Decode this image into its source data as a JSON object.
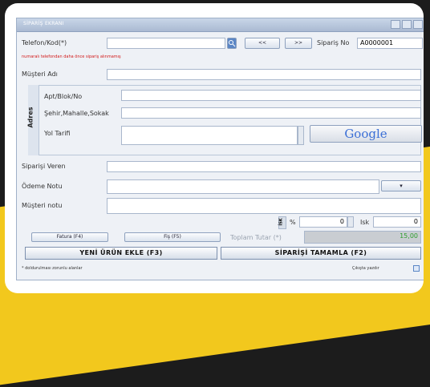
{
  "window": {
    "title": "SİPARİŞ EKRANI"
  },
  "form": {
    "telefon_label": "Telefon/Kod(*)",
    "telefon_value": "",
    "btn_prev": "<<",
    "btn_next": ">>",
    "siparis_no_label": "Sipariş No",
    "siparis_no_value": "A0000001",
    "warning": "numaralı telefondan daha önce sipariş alınmamış",
    "musteri_adi_label": "Müşteri Adı",
    "adres_label": "Adres",
    "apt_label": "Apt/Blok/No",
    "sehir_label": "Şehir,Mahalle,Sokak",
    "yol_tarifi_label": "Yol Tarifi",
    "google_label": "Google",
    "siparisi_veren_label": "Siparişi Veren",
    "odeme_notu_label": "Ödeme Notu",
    "musteri_notu_label": "Müşteri notu",
    "iskonto_label": "İSK",
    "percent_label": "%",
    "percent_value": "0",
    "isk_label": "Isk",
    "isk_value": "0",
    "btn_f4": "Fatura (F4)",
    "btn_f5": "Fiş (F5)",
    "toplam_label": "Toplam Tutar (*)",
    "toplam_value": "15,00",
    "btn_add_product": "YENİ ÜRÜN EKLE (F3)",
    "btn_complete": "SİPARİŞİ TAMAMLA (F2)",
    "footer_note": "* doldurulması zorunlu alanlar",
    "cikis_label": "Çıkışta yazdır",
    "dropdown_arrow": "▾"
  },
  "colors": {
    "accent": "#f2c81d",
    "warning": "#d21818",
    "total_bg": "#c9cdd2",
    "total_text": "#2e9e2e"
  }
}
